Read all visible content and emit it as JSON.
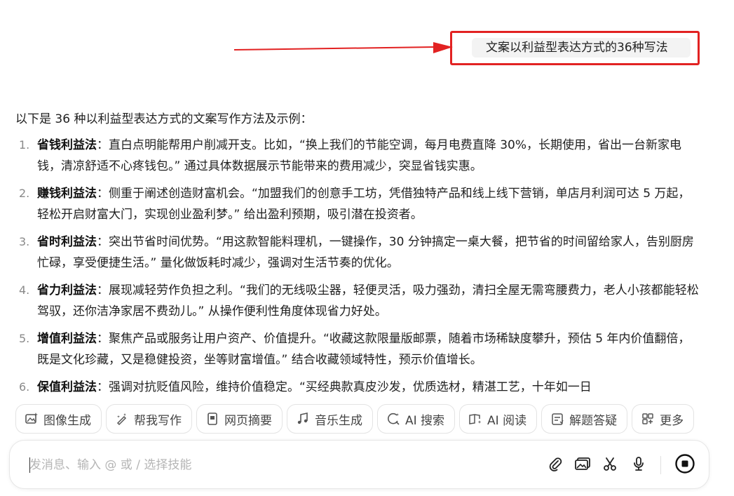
{
  "query": {
    "text": "文案以利益型表达方式的36种写法"
  },
  "answer": {
    "intro": "以下是 36 种以利益型表达方式的文案写作方法及示例：",
    "items": [
      {
        "num": "1.",
        "term": "省钱利益法",
        "desc": "：直白点明能帮用户削减开支。比如，“换上我们的节能空调，每月电费直降 30%，长期使用，省出一台新家电钱，清凉舒适不心疼钱包。” 通过具体数据展示节能带来的费用减少，突显省钱实惠。"
      },
      {
        "num": "2.",
        "term": "赚钱利益法",
        "desc": "：侧重于阐述创造财富机会。“加盟我们的创意手工坊，凭借独特产品和线上线下营销，单店月利润可达 5 万起，轻松开启财富大门，实现创业盈利梦。” 给出盈利预期，吸引潜在投资者。"
      },
      {
        "num": "3.",
        "term": "省时利益法",
        "desc": "：突出节省时间优势。“用这款智能料理机，一键操作，30 分钟搞定一桌大餐，把节省的时间留给家人，告别厨房忙碌，享受便捷生活。” 量化做饭耗时减少，强调对生活节奏的优化。"
      },
      {
        "num": "4.",
        "term": "省力利益法",
        "desc": "：展现减轻劳作负担之利。“我们的无线吸尘器，轻便灵活，吸力强劲，清扫全屋无需弯腰费力，老人小孩都能轻松驾驭，还你洁净家居不费劲儿。” 从操作便利性角度体现省力好处。"
      },
      {
        "num": "5.",
        "term": "增值利益法",
        "desc": "：聚焦产品或服务让用户资产、价值提升。“收藏这款限量版邮票，随着市场稀缺度攀升，预估 5 年内价值翻倍，既是文化珍藏，又是稳健投资，坐等财富增值。” 结合收藏领域特性，预示价值增长。"
      },
      {
        "num": "6.",
        "term": "保值利益法",
        "desc": "：强调对抗贬值风险，维持价值稳定。“买经典款真皮沙发，优质选材，精湛工艺，十年如一日"
      }
    ]
  },
  "skills": [
    {
      "label": "图像生成",
      "icon": "image-gen-icon"
    },
    {
      "label": "帮我写作",
      "icon": "write-icon"
    },
    {
      "label": "网页摘要",
      "icon": "webpage-summary-icon"
    },
    {
      "label": "音乐生成",
      "icon": "music-icon"
    },
    {
      "label": "AI 搜索",
      "icon": "ai-search-icon"
    },
    {
      "label": "AI 阅读",
      "icon": "ai-read-icon"
    },
    {
      "label": "解题答疑",
      "icon": "solve-icon"
    },
    {
      "label": "更多",
      "icon": "more-apps-icon"
    }
  ],
  "input": {
    "placeholder": "发消息、输入 @ 或 / 选择技能"
  },
  "colors": {
    "annotation": "#e22222",
    "bubble": "#f3f3f3",
    "muted": "#8a8a8a"
  }
}
